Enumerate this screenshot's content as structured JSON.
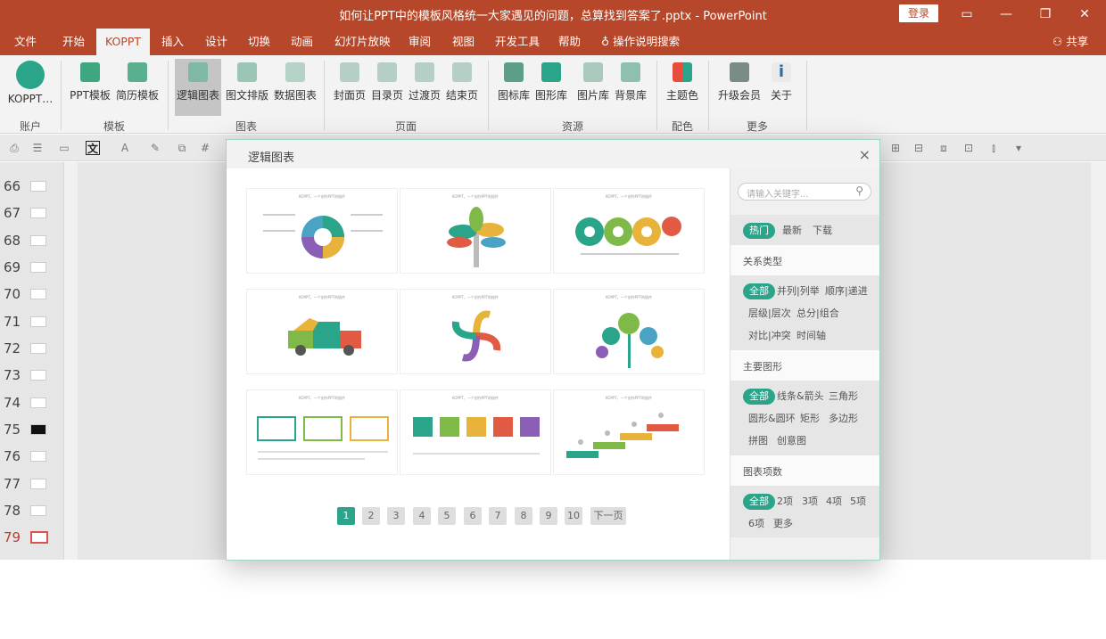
{
  "window": {
    "title": "如何让PPT中的模板风格统一大家遇见的问题，总算找到答案了.pptx  -  PowerPoint",
    "login": "登录"
  },
  "menu": {
    "tabs": [
      "文件",
      "开始",
      "KOPPT",
      "插入",
      "设计",
      "切换",
      "动画",
      "幻灯片放映",
      "审阅",
      "视图",
      "开发工具",
      "帮助"
    ],
    "search": "操作说明搜索",
    "share": "共享"
  },
  "ribbon": {
    "buttons": [
      {
        "label": "KOPPT…"
      },
      {
        "label": "PPT模板"
      },
      {
        "label": "简历模板"
      },
      {
        "label": "逻辑图表"
      },
      {
        "label": "图文排版"
      },
      {
        "label": "数据图表"
      },
      {
        "label": "封面页"
      },
      {
        "label": "目录页"
      },
      {
        "label": "过渡页"
      },
      {
        "label": "结束页"
      },
      {
        "label": "图标库"
      },
      {
        "label": "图形库"
      },
      {
        "label": "图片库"
      },
      {
        "label": "背景库"
      },
      {
        "label": "主题色"
      },
      {
        "label": "升级会员"
      },
      {
        "label": "关于"
      }
    ],
    "groups": [
      "账户",
      "模板",
      "图表",
      "页面",
      "资源",
      "配色",
      "更多"
    ]
  },
  "slides": [
    "66",
    "67",
    "68",
    "69",
    "70",
    "71",
    "72",
    "73",
    "74",
    "75",
    "76",
    "77",
    "78",
    "79"
  ],
  "dialog": {
    "title": "逻辑图表",
    "close": "×",
    "card_caption": "KOPPT，一个创作PPT的插件",
    "pages": [
      "1",
      "2",
      "3",
      "4",
      "5",
      "6",
      "7",
      "8",
      "9",
      "10"
    ],
    "next": "下一页",
    "search_placeholder": "请输入关键字...",
    "sort_tabs": [
      "热门",
      "最新",
      "下载"
    ],
    "relation": {
      "heading": "关系类型",
      "items": [
        "全部",
        "并列|列举",
        "顺序|递进",
        "层级|层次",
        "总分|组合",
        "对比|冲突",
        "时间轴"
      ]
    },
    "shapes": {
      "heading": "主要图形",
      "items": [
        "全部",
        "线条&箭头",
        "三角形",
        "圆形&圆环",
        "矩形",
        "多边形",
        "拼图",
        "创意图"
      ]
    },
    "count": {
      "heading": "图表项数",
      "items": [
        "全部",
        "2项",
        "3项",
        "4项",
        "5项",
        "6项",
        "更多"
      ]
    }
  }
}
